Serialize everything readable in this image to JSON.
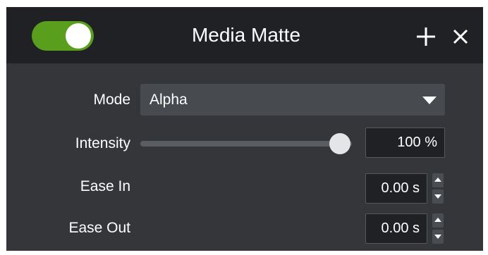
{
  "header": {
    "title": "Media Matte",
    "enabled": true,
    "toggle_color": "#5a9e1e",
    "icons": [
      "plus-icon",
      "close-icon"
    ]
  },
  "properties": {
    "mode": {
      "label": "Mode",
      "value": "Alpha"
    },
    "intensity": {
      "label": "Intensity",
      "value": "100 %",
      "level": 1.0
    },
    "ease_in": {
      "label": "Ease In",
      "value": "0.00 s"
    },
    "ease_out": {
      "label": "Ease Out",
      "value": "0.00 s"
    }
  }
}
